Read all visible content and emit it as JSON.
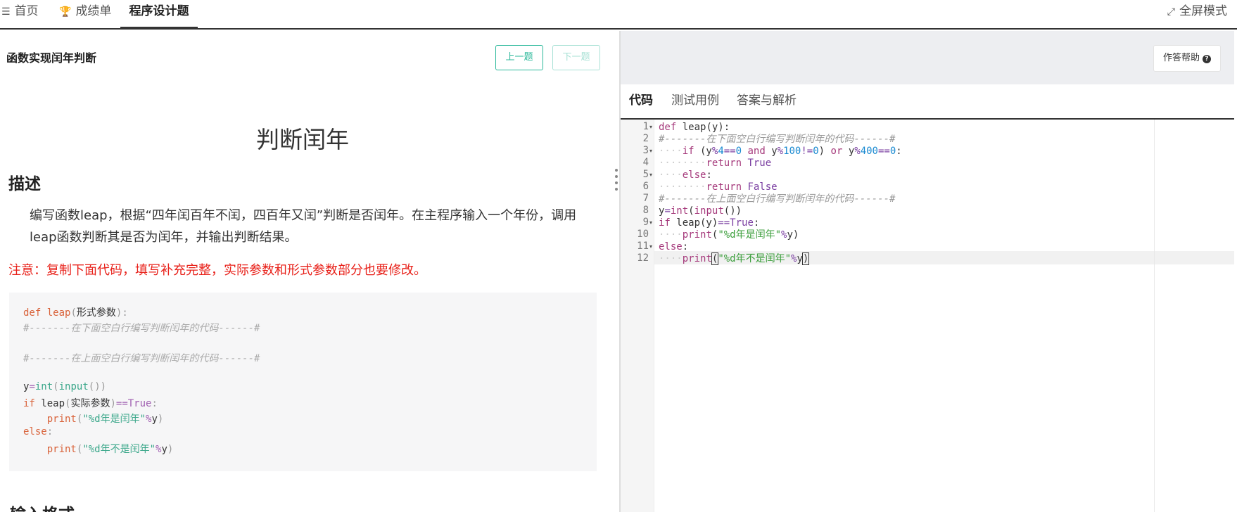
{
  "nav": {
    "home": "首页",
    "rank": "成绩单",
    "programming": "程序设计题",
    "fullscreen": "全屏模式"
  },
  "question": {
    "title": "函数实现闰年判断",
    "prev": "上一题",
    "next": "下一题",
    "doc_title": "判断闰年",
    "section_desc": "描述",
    "description": "编写函数leap，根据“四年闰百年不闰，四百年又闰”判断是否闰年。在主程序输入一个年份，调用leap函数判断其是否为闰年，并输出判断结果。",
    "note": "注意：复制下面代码，填写补充完整，实际参数和形式参数部分也要修改。",
    "section_input": "输入格式",
    "code": [
      "def leap(形式参数):",
      "#-------在下面空白行编写判断闰年的代码------#",
      "",
      "#-------在上面空白行编写判断闰年的代码------#",
      "",
      "y=int(input())",
      "if leap(实际参数)==True:",
      "    print(\"%d年是闰年\"%y)",
      "else:",
      "    print(\"%d年不是闰年\"%y)"
    ]
  },
  "editor": {
    "help": "作答帮助",
    "tabs": [
      "代码",
      "测试用例",
      "答案与解析"
    ],
    "lines": [
      "def leap(y):",
      "#-------在下面空白行编写判断闰年的代码------#",
      "    if (y%4==0 and y%100!=0) or y%400==0:",
      "        return True",
      "    else:",
      "        return False",
      "#-------在上面空白行编写判断闰年的代码------#",
      "y=int(input())",
      "if leap(y)==True:",
      "    print(\"%d年是闰年\"%y)",
      "else:",
      "    print(\"%d年不是闰年\"%y)"
    ],
    "line_numbers": [
      "1",
      "2",
      "3",
      "4",
      "5",
      "6",
      "7",
      "8",
      "9",
      "10",
      "11",
      "12"
    ]
  }
}
